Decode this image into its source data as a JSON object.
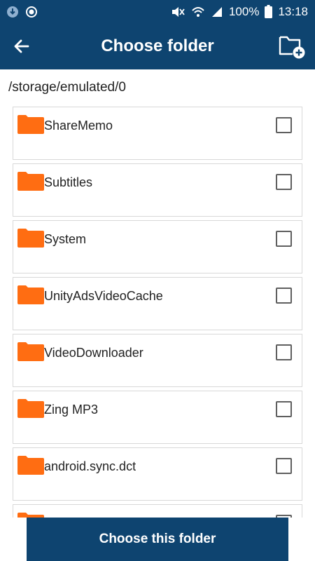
{
  "status_bar": {
    "battery": "100%",
    "time": "13:18"
  },
  "header": {
    "title": "Choose folder",
    "back_icon": "arrow-left-icon",
    "action_icon": "folder-plus-icon"
  },
  "path": "/storage/emulated/0",
  "folders": [
    {
      "name": "ShareMemo",
      "checked": false
    },
    {
      "name": "Subtitles",
      "checked": false
    },
    {
      "name": "System",
      "checked": false
    },
    {
      "name": "UnityAdsVideoCache",
      "checked": false
    },
    {
      "name": "VideoDownloader",
      "checked": false
    },
    {
      "name": "Zing MP3",
      "checked": false
    },
    {
      "name": "android.sync.dct",
      "checked": false
    },
    {
      "name": "",
      "checked": false
    }
  ],
  "footer": {
    "choose_label": "Choose this folder"
  },
  "colors": {
    "primary": "#0e4470",
    "folder": "#ff6d12",
    "checkbox_border": "#5f5f5f",
    "card_border": "#d8d8d8"
  }
}
